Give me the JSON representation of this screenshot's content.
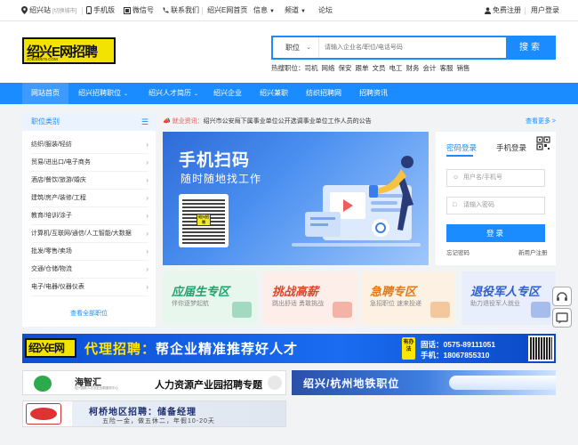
{
  "topbar": {
    "site_label": "绍兴站",
    "switch_city": "[切换城市]",
    "mobile": "手机版",
    "wechat": "微信号",
    "contact": "联系我们",
    "home": "绍兴E网首页",
    "info": "信息",
    "channel": "频道",
    "forum": "论坛",
    "register": "免费注册",
    "login": "用户登录"
  },
  "header": {
    "logo_text": "绍兴E网招聘",
    "logo_url": "JOB.E0575.COM",
    "search_type": "职位",
    "search_placeholder": "请输入企业名/职位/电话号码",
    "search_button": "搜索",
    "hot_label": "热搜职位：",
    "hot_items": [
      "司机",
      "网络",
      "保安",
      "跟单",
      "文员",
      "电工",
      "财务",
      "会计",
      "客服",
      "销售"
    ]
  },
  "nav": {
    "items": [
      {
        "label": "网站首页"
      },
      {
        "label": "绍兴招聘职位"
      },
      {
        "label": "绍兴人才简历"
      },
      {
        "label": "绍兴企业"
      },
      {
        "label": "绍兴兼职"
      },
      {
        "label": "纺织招聘网"
      },
      {
        "label": "招聘资讯"
      }
    ]
  },
  "sidebar": {
    "title": "职位类别",
    "items": [
      "纺织/服装/轻纺",
      "贸易/进出口/电子商务",
      "酒店/餐饮/旅游/婚庆",
      "建筑/房产/装修/工程",
      "教育/培训/涂子",
      "计算机/互联网/通信/人工智能/大数据",
      "批发/零售/卖场",
      "交通/仓储/物流",
      "电子/电器/仪器仪表"
    ],
    "more": "查看全部职位"
  },
  "notice": {
    "tag": "就业资讯：",
    "text": "绍兴市公安局下属事业单位公开选调事业单位工作人员的公告",
    "view_more": "查看更多 >"
  },
  "banner": {
    "title": "手机扫码",
    "subtitle": "随时随地找工作",
    "qr_label": "绍兴招聘"
  },
  "login": {
    "tab_password": "密码登录",
    "tab_phone": "手机登录",
    "username_placeholder": "用户名/手机号",
    "password_placeholder": "请输入密码",
    "submit": "登录",
    "forgot": "忘记密码",
    "new_user": "新用户注册"
  },
  "zones": [
    {
      "title": "应届生专区",
      "subtitle": "伴你逐梦起航",
      "color": "#1ea36a",
      "bg": "#e8f7ee"
    },
    {
      "title": "挑战高薪",
      "subtitle": "跳出舒适 勇敢挑战",
      "color": "#e0452b",
      "bg": "#fdeeea"
    },
    {
      "title": "急聘专区",
      "subtitle": "急招职位 速来投递",
      "color": "#e07a1a",
      "bg": "#fdf1e3"
    },
    {
      "title": "退役军人专区",
      "subtitle": "助力退役军人就业",
      "color": "#2b5fd0",
      "bg": "#e8eefc"
    }
  ],
  "ads": {
    "ad1_logo": "绍兴E网",
    "ad1_title_a": "代理招聘：",
    "ad1_title_b": "帮企业精准推荐好人才",
    "ad1_badge": "有办法",
    "ad1_phone1": "固话：0575-89111051",
    "ad1_phone2": "手机：18067855310",
    "ad2_name": "海智汇",
    "ad2_sub": "绍兴国际人才创业创新服务中心",
    "ad2_title": "人力资源产业园招聘专题",
    "ad3_title": "绍兴/杭州地铁职位",
    "ad4_title": "柯桥地区招聘：储备经理",
    "ad4_sub": "五险一金，做五休二，年假10-20天"
  }
}
